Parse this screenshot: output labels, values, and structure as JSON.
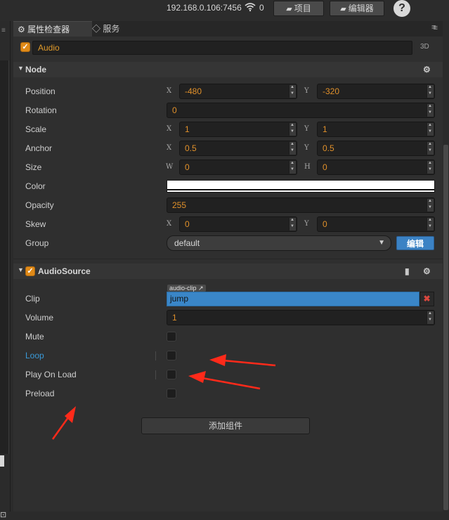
{
  "topbar": {
    "ip": "192.168.0.106:7456",
    "count": "0",
    "project_label": "项目",
    "editor_label": "编辑器",
    "help_label": "?"
  },
  "tabs": {
    "inspector": "属性检查器",
    "service": "服务"
  },
  "node": {
    "name": "Audio",
    "tag3d": "3D",
    "section_title": "Node",
    "props": {
      "position": {
        "label": "Position",
        "x_axis": "X",
        "x": "-480",
        "y_axis": "Y",
        "y": "-320"
      },
      "rotation": {
        "label": "Rotation",
        "value": "0"
      },
      "scale": {
        "label": "Scale",
        "x_axis": "X",
        "x": "1",
        "y_axis": "Y",
        "y": "1"
      },
      "anchor": {
        "label": "Anchor",
        "x_axis": "X",
        "x": "0.5",
        "y_axis": "Y",
        "y": "0.5"
      },
      "size": {
        "label": "Size",
        "w_axis": "W",
        "w": "0",
        "h_axis": "H",
        "h": "0"
      },
      "color": {
        "label": "Color",
        "value": "#ffffff"
      },
      "opacity": {
        "label": "Opacity",
        "value": "255"
      },
      "skew": {
        "label": "Skew",
        "x_axis": "X",
        "x": "0",
        "y_axis": "Y",
        "y": "0"
      },
      "group": {
        "label": "Group",
        "value": "default",
        "edit_label": "编辑"
      }
    }
  },
  "audio_source": {
    "section_title": "AudioSource",
    "enabled": true,
    "clip": {
      "label": "Clip",
      "tag": "audio-clip",
      "value": "jump"
    },
    "volume": {
      "label": "Volume",
      "value": "1"
    },
    "mute": {
      "label": "Mute",
      "checked": false
    },
    "loop": {
      "label": "Loop",
      "checked": false
    },
    "play_on_load": {
      "label": "Play On Load",
      "checked": false
    },
    "preload": {
      "label": "Preload",
      "checked": false
    }
  },
  "add_component_label": "添加组件",
  "colors": {
    "accent_orange": "#e08a18",
    "clip_blue": "#3a86c8",
    "edit_blue": "#3b82c4",
    "annotation_red": "#ff2a1a"
  }
}
